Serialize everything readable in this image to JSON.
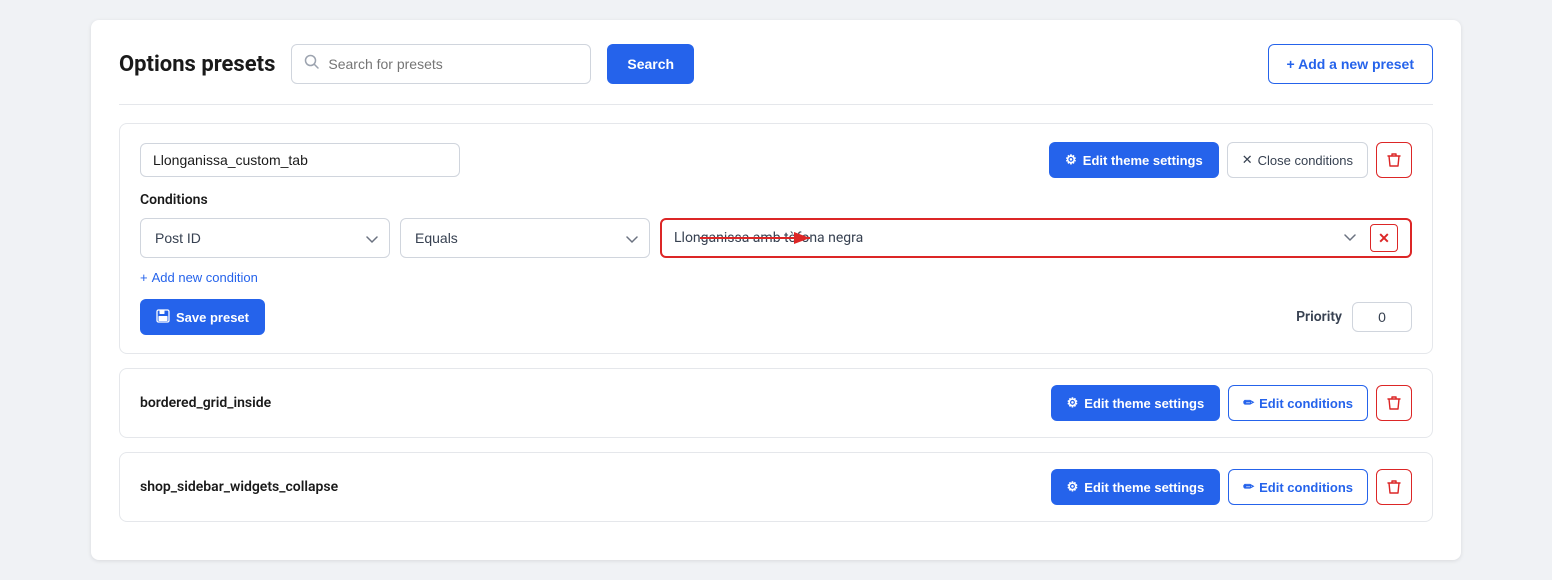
{
  "page": {
    "title": "Options presets",
    "search": {
      "placeholder": "Search for presets",
      "button_label": "Search"
    },
    "add_preset_btn": "+ Add a new preset"
  },
  "expanded_preset": {
    "name": "Llonganissa_custom_tab",
    "edit_theme_label": "Edit theme settings",
    "close_conditions_label": "Close conditions",
    "conditions_heading": "Conditions",
    "condition_field": "Post ID",
    "condition_operator": "Equals",
    "condition_value": "Llonganissa amb tòfona negra",
    "add_condition_label": "Add new condition",
    "save_preset_label": "Save preset",
    "priority_label": "Priority",
    "priority_value": "0"
  },
  "preset_rows": [
    {
      "name": "bordered_grid_inside",
      "edit_theme_label": "Edit theme settings",
      "edit_conditions_label": "Edit conditions"
    },
    {
      "name": "shop_sidebar_widgets_collapse",
      "edit_theme_label": "Edit theme settings",
      "edit_conditions_label": "Edit conditions"
    }
  ],
  "icons": {
    "search": "🔍",
    "gear": "⚙",
    "close": "✕",
    "plus": "+",
    "save": "💾",
    "pencil": "✏",
    "trash": "🗑",
    "chevron_down": "∨",
    "arrow_right": "→"
  }
}
